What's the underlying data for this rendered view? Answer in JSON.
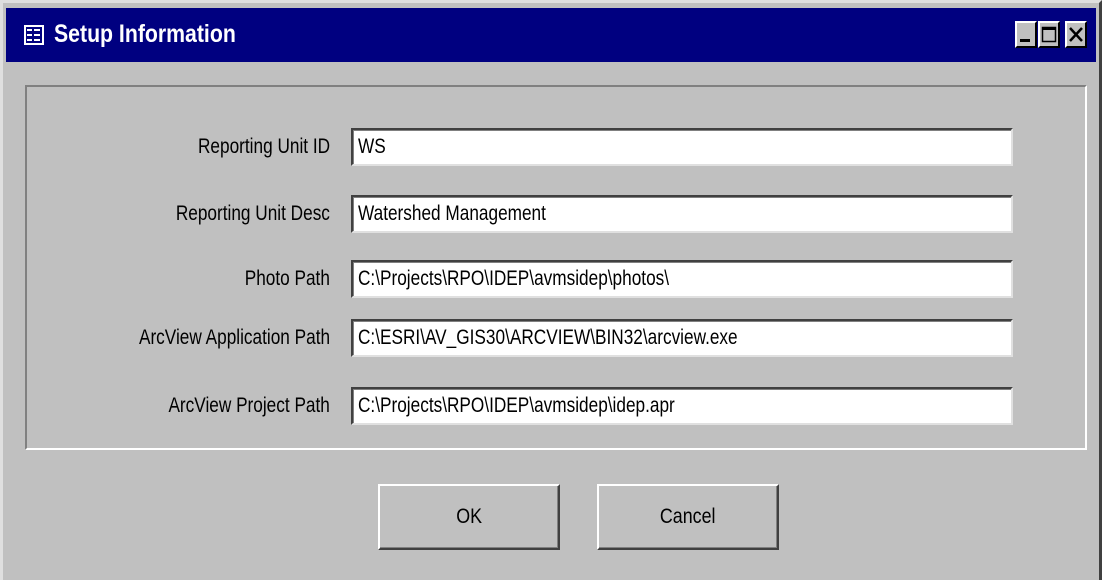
{
  "window": {
    "title": "Setup Information",
    "icon": "form-icon",
    "controls": {
      "minimize_icon": "minimize-icon",
      "maximize_icon": "maximize-icon",
      "close_icon": "close-icon"
    }
  },
  "form": {
    "fields": [
      {
        "label": "Reporting Unit ID",
        "value": "WS"
      },
      {
        "label": "Reporting Unit Desc",
        "value": "Watershed Management"
      },
      {
        "label": "Photo Path",
        "value": "C:\\Projects\\RPO\\IDEP\\avmsidep\\photos\\"
      },
      {
        "label": "ArcView Application Path",
        "value": "C:\\ESRI\\AV_GIS30\\ARCVIEW\\BIN32\\arcview.exe"
      },
      {
        "label": "ArcView Project Path",
        "value": "C:\\Projects\\RPO\\IDEP\\avmsidep\\idep.apr"
      }
    ]
  },
  "buttons": {
    "ok_label": "OK",
    "cancel_label": "Cancel"
  },
  "colors": {
    "titlebar": "#000080",
    "face": "#c0c0c0"
  }
}
